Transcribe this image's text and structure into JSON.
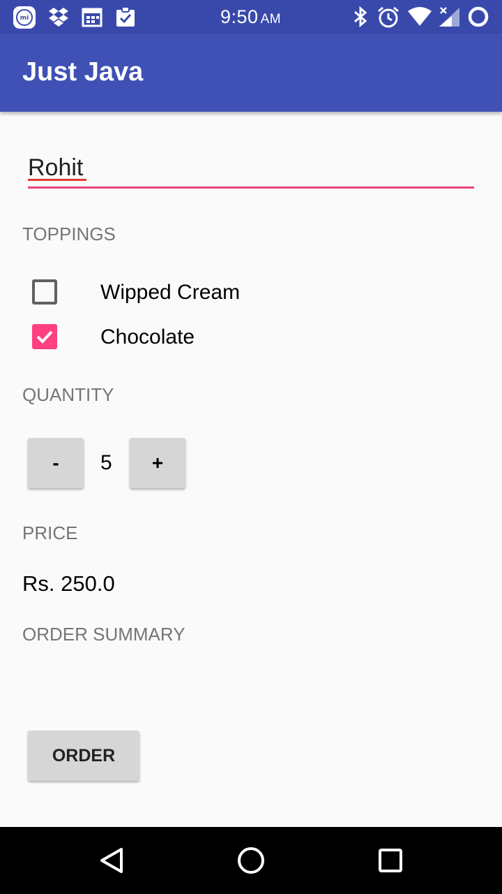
{
  "status_bar": {
    "time": "9:50",
    "ampm": "AM",
    "left_icons": [
      "mi-icon",
      "dropbox-icon",
      "calendar-icon",
      "clipboard-check-icon"
    ],
    "right_icons": [
      "bluetooth-icon",
      "alarm-icon",
      "wifi-icon",
      "signal-icon",
      "battery-ring-icon"
    ]
  },
  "app_bar": {
    "title": "Just Java"
  },
  "name_field": {
    "value": "Rohit"
  },
  "toppings": {
    "label": "TOPPINGS",
    "items": [
      {
        "label": "Wipped Cream",
        "checked": false
      },
      {
        "label": "Chocolate",
        "checked": true
      }
    ]
  },
  "quantity": {
    "label": "QUANTITY",
    "decrement_label": "-",
    "value": "5",
    "increment_label": "+"
  },
  "price": {
    "label": "PRICE",
    "value": "Rs. 250.0"
  },
  "order_summary": {
    "label": "ORDER SUMMARY"
  },
  "order_button": {
    "label": "ORDER"
  },
  "navigation": {
    "buttons": [
      "back-icon",
      "home-icon",
      "recents-icon"
    ]
  },
  "colors": {
    "status_bar": "#3949ab",
    "app_bar": "#3f51b5",
    "accent": "#ff4081",
    "field_underline": "#e8457a",
    "background": "#fafafa",
    "button": "#d6d6d6"
  }
}
